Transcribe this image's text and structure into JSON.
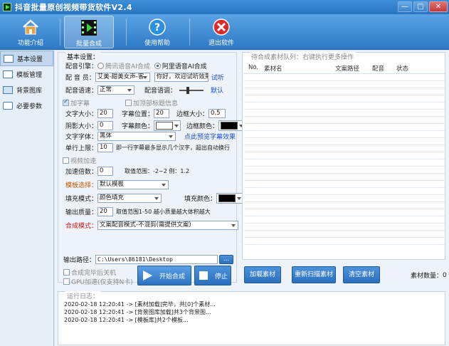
{
  "window": {
    "title": "抖音批量原创视频带货软件V2.4",
    "minimize": "—",
    "maximize": "□",
    "close": "✕"
  },
  "toolbar": [
    {
      "label": "功能介绍",
      "icon": "home-icon"
    },
    {
      "label": "批量合成",
      "icon": "film-play-icon"
    },
    {
      "label": "使用帮助",
      "icon": "help-icon"
    },
    {
      "label": "退出软件",
      "icon": "exit-icon"
    }
  ],
  "sidebar": [
    {
      "label": "基本设置",
      "icon": "settings-panel-icon"
    },
    {
      "label": "模板管理",
      "icon": "template-icon"
    },
    {
      "label": "背景图库",
      "icon": "image-library-icon"
    },
    {
      "label": "必要参数",
      "icon": "parameters-icon"
    }
  ],
  "settings": {
    "legend": "基本设置：",
    "engine_label": "配音引擎：",
    "engine_opt1": "腾讯语音AI合成",
    "engine_opt2": "阿里语音AI合成",
    "voice_label": "配 音 员：",
    "voice_value": "艾美-甜美女声-客",
    "voice_text": "你好，欢迎试听效果!",
    "voice_try": "试听",
    "speed_label": "配音语速：",
    "speed_value": "正常",
    "pitch_label": "配音语调：",
    "pitch_default": "默认",
    "subtitle_check": "加字幕",
    "top_title_check": "加顶部标题信息",
    "font_size_label": "文字大小：",
    "font_size_value": "20",
    "sub_pos_label": "字幕位置：",
    "sub_pos_value": "20",
    "border_size_label": "边框大小：",
    "border_size_value": "0.5",
    "shadow_label": "阴影大小：",
    "shadow_value": "0",
    "sub_color_label": "字幕颜色：",
    "border_color_label": "边框颜色：",
    "font_label": "文字字体：",
    "font_value": "黑体",
    "preview_link": "点此预览字幕效果",
    "line_limit_label": "单行上限：",
    "line_limit_value": "10",
    "line_limit_hint": "即一行字幕最多显示几个汉字，超出自动换行",
    "video_speed_check": "视频加速",
    "speed_mult_label": "加速倍数：",
    "speed_mult_value": "0",
    "speed_mult_hint": "取值范围：-2~2  例：1.2",
    "template_label": "模板选择：",
    "template_value": "默认模板",
    "fill_mode_label": "填充模式：",
    "fill_mode_value": "颜色填充",
    "fill_color_label": "填充颜色：",
    "quality_label": "输出质量：",
    "quality_value": "20",
    "quality_hint": "取值范围1-50 越小质量越大体积越大",
    "compose_label": "合成模式：",
    "compose_value": "文案配音模式-不混剪(需提供文案)"
  },
  "output": {
    "path_label": "输出路径：",
    "path_value": "C:\\Users\\86181\\Desktop",
    "browse": "...",
    "shutdown_check": "合成完毕后关机",
    "gpu_check": "GPU加速(仅支持N卡)",
    "start": "开始合成",
    "stop": "停止"
  },
  "queue": {
    "legend": "待合成素材队列：右键执行更多操作",
    "columns": [
      "No.",
      "素材名",
      "文案路径",
      "配音",
      "状态"
    ],
    "load": "加载素材",
    "rescan": "重新扫描素材",
    "clear": "清空素材",
    "count_label": "素材数量：",
    "count_value": "0"
  },
  "log": {
    "legend": "运行日志：",
    "lines": [
      "2020-02-18 12:20:41 -> [素材加载]完毕，共[0]个素材...",
      "2020-02-18 12:20:41 -> [背景图库加载]共3个背景图...",
      "2020-02-18 12:20:41 -> [模板库]共2个模板..."
    ]
  },
  "colors": {
    "sub_color": "#ffffff",
    "border_color": "#000000",
    "fill_color": "#000000"
  }
}
